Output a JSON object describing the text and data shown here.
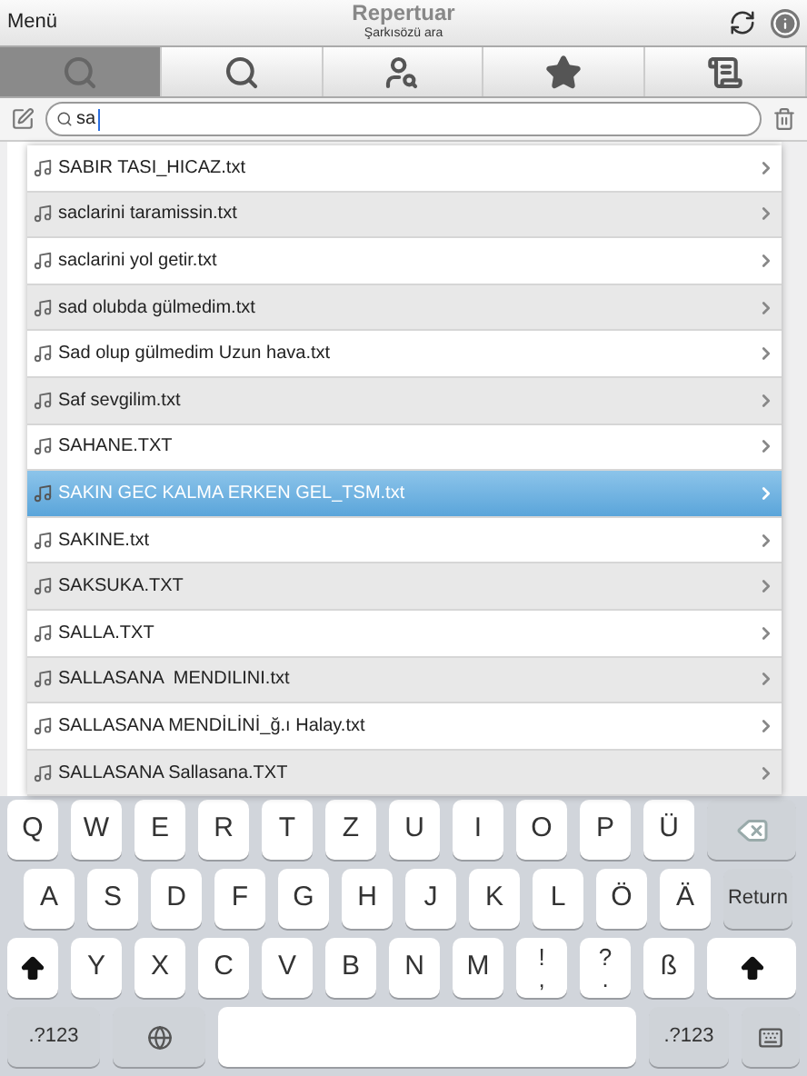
{
  "header": {
    "left_button": "Menü",
    "title": "Repertuar",
    "subtitle": "Şarkısözü ara"
  },
  "tabs": [
    {
      "kind": "search",
      "selected": true
    },
    {
      "kind": "search",
      "selected": false
    },
    {
      "kind": "person",
      "selected": false
    },
    {
      "kind": "star",
      "selected": false
    },
    {
      "kind": "document",
      "selected": false
    }
  ],
  "search": {
    "value": "sa"
  },
  "results": [
    {
      "label": "SABIR TASI_HICAZ.txt",
      "selected": false
    },
    {
      "label": "saclarini taramissin.txt",
      "selected": false
    },
    {
      "label": "saclarini yol getir.txt",
      "selected": false
    },
    {
      "label": "sad olubda gülmedim.txt",
      "selected": false
    },
    {
      "label": "Sad olup gülmedim Uzun hava.txt",
      "selected": false
    },
    {
      "label": "Saf sevgilim.txt",
      "selected": false
    },
    {
      "label": "SAHANE.TXT",
      "selected": false
    },
    {
      "label": "SAKIN GEC KALMA ERKEN GEL_TSM.txt",
      "selected": true
    },
    {
      "label": "SAKINE.txt",
      "selected": false
    },
    {
      "label": "SAKSUKA.TXT",
      "selected": false
    },
    {
      "label": "SALLA.TXT",
      "selected": false
    },
    {
      "label": "SALLASANA  MENDILINI.txt",
      "selected": false
    },
    {
      "label": "SALLASANA MENDİLİNİ_ğ.ı Halay.txt",
      "selected": false
    },
    {
      "label": "SALLASANA Sallasana.TXT",
      "selected": false
    }
  ],
  "keyboard": [
    [
      {
        "kind": "char",
        "label": "Q"
      },
      {
        "kind": "char",
        "label": "W"
      },
      {
        "kind": "char",
        "label": "E"
      },
      {
        "kind": "char",
        "label": "R"
      },
      {
        "kind": "char",
        "label": "T"
      },
      {
        "kind": "char",
        "label": "Z"
      },
      {
        "kind": "char",
        "label": "U"
      },
      {
        "kind": "char",
        "label": "I"
      },
      {
        "kind": "char",
        "label": "O"
      },
      {
        "kind": "char",
        "label": "P"
      },
      {
        "kind": "char",
        "label": "Ü"
      },
      {
        "kind": "backspace"
      }
    ],
    [
      {
        "kind": "char",
        "label": "A"
      },
      {
        "kind": "char",
        "label": "S"
      },
      {
        "kind": "char",
        "label": "D"
      },
      {
        "kind": "char",
        "label": "F"
      },
      {
        "kind": "char",
        "label": "G"
      },
      {
        "kind": "char",
        "label": "H"
      },
      {
        "kind": "char",
        "label": "J"
      },
      {
        "kind": "char",
        "label": "K"
      },
      {
        "kind": "char",
        "label": "L"
      },
      {
        "kind": "char",
        "label": "Ö"
      },
      {
        "kind": "char",
        "label": "Ä"
      },
      {
        "kind": "return",
        "label": "Return"
      }
    ],
    [
      {
        "kind": "shift"
      },
      {
        "kind": "char",
        "label": "Y"
      },
      {
        "kind": "char",
        "label": "X"
      },
      {
        "kind": "char",
        "label": "C"
      },
      {
        "kind": "char",
        "label": "V"
      },
      {
        "kind": "char",
        "label": "B"
      },
      {
        "kind": "char",
        "label": "N"
      },
      {
        "kind": "char",
        "label": "M"
      },
      {
        "kind": "dual",
        "top": "!",
        "bottom": ","
      },
      {
        "kind": "dual",
        "top": "?",
        "bottom": "."
      },
      {
        "kind": "char",
        "label": "ß"
      },
      {
        "kind": "shift"
      }
    ],
    [
      {
        "kind": "mode",
        "label": ".?123"
      },
      {
        "kind": "globe"
      },
      {
        "kind": "space"
      },
      {
        "kind": "mode",
        "label": ".?123"
      },
      {
        "kind": "hide"
      }
    ]
  ]
}
